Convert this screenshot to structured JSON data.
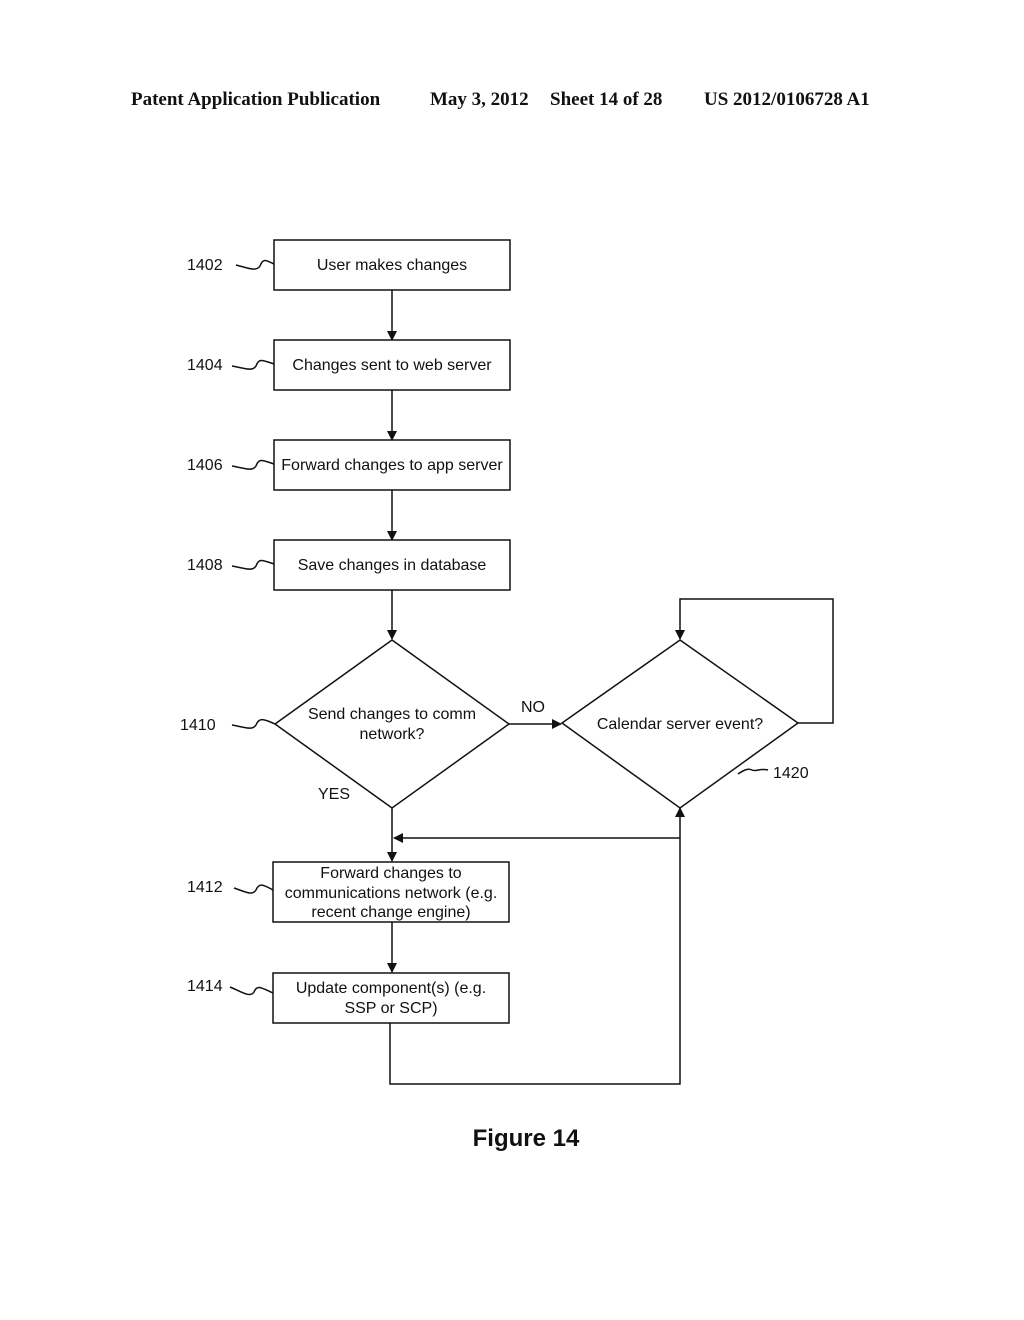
{
  "header": {
    "publication": "Patent Application Publication",
    "date": "May 3, 2012",
    "sheet": "Sheet 14 of 28",
    "number": "US 2012/0106728 A1"
  },
  "diagram": {
    "nodes": [
      {
        "id": "1402",
        "ref": "1402",
        "type": "process",
        "lines": [
          "User makes changes"
        ]
      },
      {
        "id": "1404",
        "ref": "1404",
        "type": "process",
        "lines": [
          "Changes sent to web server"
        ]
      },
      {
        "id": "1406",
        "ref": "1406",
        "type": "process",
        "lines": [
          "Forward changes to app server"
        ]
      },
      {
        "id": "1408",
        "ref": "1408",
        "type": "process",
        "lines": [
          "Save changes in database"
        ]
      },
      {
        "id": "1410",
        "ref": "1410",
        "type": "decision",
        "lines": [
          "Send changes to comm",
          "network?"
        ]
      },
      {
        "id": "1420",
        "ref": "1420",
        "type": "decision",
        "lines": [
          "Calendar server event?"
        ]
      },
      {
        "id": "1412",
        "ref": "1412",
        "type": "process",
        "lines": [
          "Forward changes to",
          "communications network (e.g.",
          "recent change engine)"
        ]
      },
      {
        "id": "1414",
        "ref": "1414",
        "type": "process",
        "lines": [
          "Update component(s) (e.g.",
          "SSP or SCP)"
        ]
      }
    ],
    "edges": [
      {
        "from": "1402",
        "to": "1404",
        "label": ""
      },
      {
        "from": "1404",
        "to": "1406",
        "label": ""
      },
      {
        "from": "1406",
        "to": "1408",
        "label": ""
      },
      {
        "from": "1408",
        "to": "1410",
        "label": ""
      },
      {
        "from": "1410",
        "to": "1420",
        "label": "NO"
      },
      {
        "from": "1410",
        "to": "1412",
        "label": "YES"
      },
      {
        "from": "1420",
        "to": "1420",
        "label": ""
      },
      {
        "from": "1420",
        "to": "1412",
        "label": ""
      },
      {
        "from": "1412",
        "to": "1414",
        "label": ""
      },
      {
        "from": "1414",
        "to": "1420",
        "label": ""
      }
    ],
    "labels": {
      "no": "NO",
      "yes": "YES"
    },
    "figure_caption": "Figure 14"
  }
}
